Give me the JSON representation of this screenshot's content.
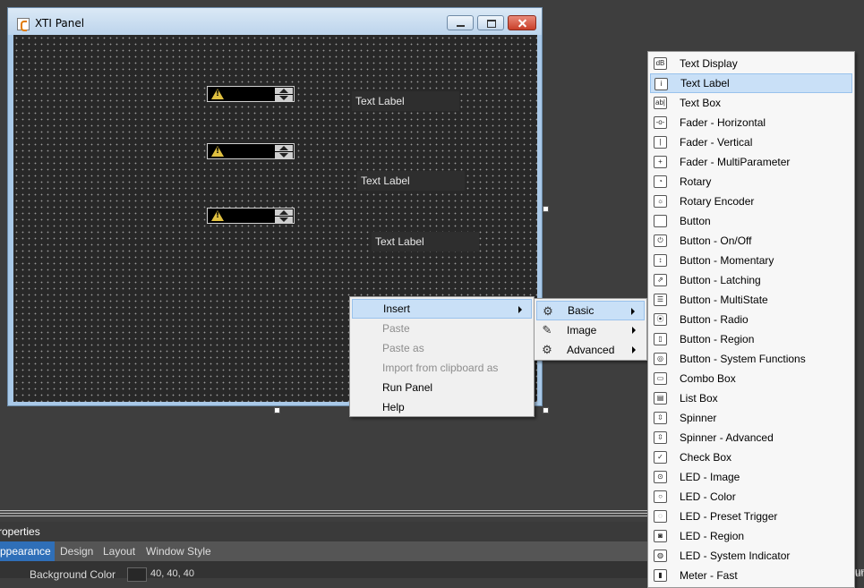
{
  "window": {
    "title": "XTI Panel"
  },
  "canvas": {
    "labels": [
      "Text Label",
      "Text Label",
      "Text Label"
    ]
  },
  "context_menu": {
    "items": [
      {
        "label": "Insert",
        "state": "highlighted",
        "submenu": true
      },
      {
        "label": "Paste",
        "state": "disabled"
      },
      {
        "label": "Paste as",
        "state": "disabled"
      },
      {
        "label": "Import from clipboard as",
        "state": "disabled"
      },
      {
        "label": "Run Panel",
        "state": "enabled"
      },
      {
        "label": "Help",
        "state": "enabled"
      }
    ]
  },
  "insert_submenu": {
    "items": [
      {
        "label": "Basic",
        "icon": "basic-controls-icon",
        "state": "highlighted"
      },
      {
        "label": "Image",
        "icon": "image-icon",
        "state": "enabled"
      },
      {
        "label": "Advanced",
        "icon": "gear-icon",
        "state": "enabled"
      }
    ]
  },
  "basic_submenu": {
    "items": [
      {
        "label": "Text Display",
        "icon": "dB"
      },
      {
        "label": "Text Label",
        "icon": "i",
        "highlighted": true
      },
      {
        "label": "Text Box",
        "icon": "ab|"
      },
      {
        "label": "Fader - Horizontal",
        "icon": "-o-"
      },
      {
        "label": "Fader - Vertical",
        "icon": "|"
      },
      {
        "label": "Fader - MultiParameter",
        "icon": "+"
      },
      {
        "label": "Rotary",
        "icon": "◔"
      },
      {
        "label": "Rotary Encoder",
        "icon": "☼"
      },
      {
        "label": "Button",
        "icon": ""
      },
      {
        "label": "Button - On/Off",
        "icon": "⏻"
      },
      {
        "label": "Button - Momentary",
        "icon": "↕"
      },
      {
        "label": "Button - Latching",
        "icon": "⇗"
      },
      {
        "label": "Button - MultiState",
        "icon": "☰"
      },
      {
        "label": "Button - Radio",
        "icon": "⦿"
      },
      {
        "label": "Button - Region",
        "icon": "▯"
      },
      {
        "label": "Button - System Functions",
        "icon": "◎"
      },
      {
        "label": "Combo Box",
        "icon": "▭"
      },
      {
        "label": "List Box",
        "icon": "▤"
      },
      {
        "label": "Spinner",
        "icon": "⇳"
      },
      {
        "label": "Spinner - Advanced",
        "icon": "⇳"
      },
      {
        "label": "Check Box",
        "icon": "✓"
      },
      {
        "label": "LED - Image",
        "icon": "⊙"
      },
      {
        "label": "LED - Color",
        "icon": "○"
      },
      {
        "label": "LED - Preset Trigger",
        "icon": "◌"
      },
      {
        "label": "LED - Region",
        "icon": "◙"
      },
      {
        "label": "LED - System Indicator",
        "icon": "◍"
      },
      {
        "label": "Meter - Fast",
        "icon": "▮"
      }
    ]
  },
  "properties": {
    "title": "roperties",
    "tabs": [
      {
        "label": "ppearance",
        "active": true
      },
      {
        "label": "Design",
        "active": false
      },
      {
        "label": "Layout",
        "active": false
      },
      {
        "label": "Window Style",
        "active": false
      }
    ],
    "row": {
      "name": "Background Color",
      "value": "40, 40, 40"
    },
    "cut_text": "un"
  },
  "colors": {
    "accent": "#2f6fb8",
    "highlight": "#c9e0f7",
    "canvas": "#282828"
  }
}
